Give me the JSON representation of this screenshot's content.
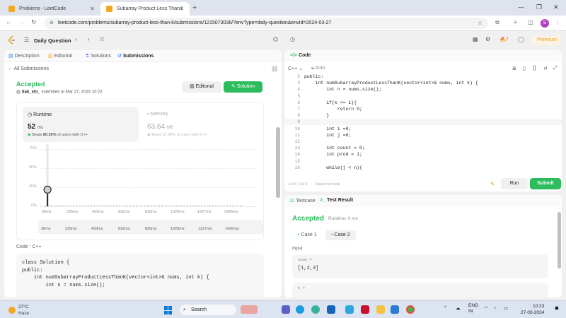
{
  "browser": {
    "tabs": [
      {
        "title": "Problems - LeetCode",
        "active": false
      },
      {
        "title": "Subarray Product Less Than K",
        "active": true
      }
    ],
    "url": "leetcode.com/problems/subarray-product-less-than-k/submissions/1215073036/?envType=daily-question&envId=2024-03-27",
    "profile_initial": "S"
  },
  "nav": {
    "title": "Daily Question",
    "streak": "7",
    "premium_label": "Premium"
  },
  "left_tabs": [
    {
      "label": "Description"
    },
    {
      "label": "Editorial"
    },
    {
      "label": "Solutions"
    },
    {
      "label": "Submissions"
    }
  ],
  "submission": {
    "back_label": "All Submissions",
    "status": "Accepted",
    "user": "Sak_shi_",
    "submitted_text": "submitted at Mar 27, 2024 10:22",
    "editorial_btn": "Editorial",
    "solution_btn": "Solution",
    "runtime_label": "Runtime",
    "runtime_value": "52",
    "runtime_unit": "ms",
    "runtime_beats_prefix": "Beats",
    "runtime_beats_pct": "80.30%",
    "runtime_beats_suffix": "of users with C++",
    "memory_label": "Memory",
    "memory_value": "63.64",
    "memory_unit": "MB",
    "memory_beats_prefix": "Beats",
    "memory_beats_pct": "57.48%",
    "memory_beats_suffix": "of users with C++",
    "code_label": "Code",
    "code_lang": "C++"
  },
  "chart_data": {
    "type": "bar",
    "yticks": [
      "75%",
      "50%",
      "25%",
      "0%"
    ],
    "ylim": [
      0,
      75
    ],
    "x_ticks": [
      "36ms",
      "235ms",
      "433ms",
      "632ms",
      "830ms",
      "1029ms",
      "1227ms",
      "1426ms"
    ],
    "range_ticks": [
      "36ms",
      "235ms",
      "433ms",
      "632ms",
      "830ms",
      "1029ms",
      "1227ms",
      "1426ms"
    ],
    "marker_ms": 52,
    "marker_pct": 20
  },
  "submitted_code": [
    "class Solution {",
    "public:",
    "    int numSubarrayProductLessThanK(vector<int>& nums, int k) {",
    "        int n = nums.size();",
    "",
    "        if(k <= 1){"
  ],
  "editor": {
    "header": "Code",
    "lang": "C++",
    "auto_label": "Auto",
    "lines": [
      {
        "n": "2",
        "code": "public:"
      },
      {
        "n": "3",
        "code": "    int numSubarrayProductLessThanK(vector<int>& nums, int k) {"
      },
      {
        "n": "4",
        "code": "        int n = nums.size();"
      },
      {
        "n": "5",
        "code": ""
      },
      {
        "n": "6",
        "code": "        if(k <= 1){"
      },
      {
        "n": "7",
        "code": "            return 0;"
      },
      {
        "n": "8",
        "code": "        }"
      },
      {
        "n": "9",
        "code": ""
      },
      {
        "n": "10",
        "code": "        int i =0;"
      },
      {
        "n": "11",
        "code": "        int j =0;"
      },
      {
        "n": "12",
        "code": ""
      },
      {
        "n": "13",
        "code": "        int count = 0;"
      },
      {
        "n": "14",
        "code": "        int prod = 1;"
      },
      {
        "n": "15",
        "code": ""
      },
      {
        "n": "16",
        "code": "        while(j < n){"
      }
    ],
    "cursor_pos": "Ln 9, Col 9",
    "save_state": "Saved to local",
    "run_btn": "Run",
    "submit_btn": "Submit"
  },
  "test": {
    "tabs": [
      {
        "label": "Testcase"
      },
      {
        "label": "Test Result"
      }
    ],
    "status": "Accepted",
    "runtime": "Runtime: 0 ms",
    "cases": [
      {
        "label": "Case 1"
      },
      {
        "label": "Case 2"
      }
    ],
    "input_label": "Input",
    "inputs": [
      {
        "name": "nums =",
        "value": "[1,2,3]"
      },
      {
        "name": "k =",
        "value": ""
      }
    ]
  },
  "taskbar": {
    "temp": "27°C",
    "weather": "Haze",
    "search": "Search",
    "lang_line1": "ENG",
    "lang_line2": "IN",
    "time": "10:23",
    "date": "27-03-2024"
  },
  "colors": {
    "accent_green": "#2cbb5d",
    "premium_orange": "#e8a020"
  }
}
